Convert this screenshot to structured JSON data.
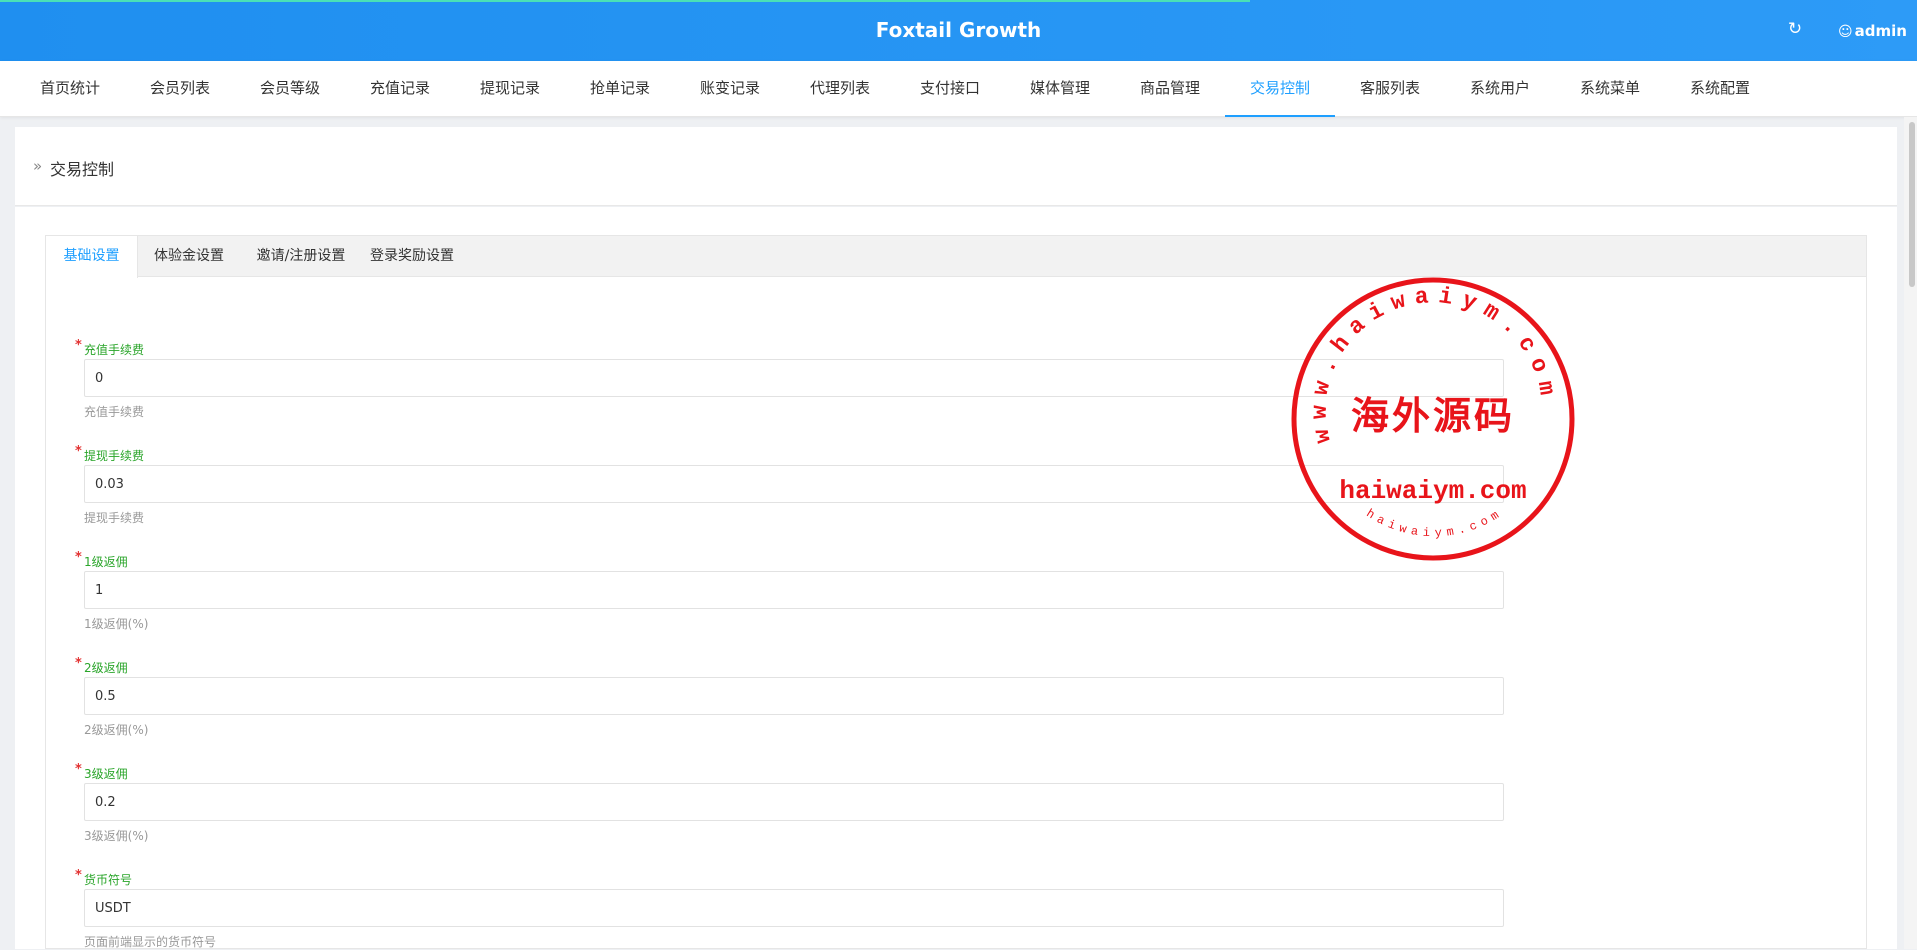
{
  "header": {
    "app_title": "Foxtail Growth",
    "refresh_icon": "refresh-icon",
    "user_icon": "user-icon",
    "user_name": "admin",
    "brand_color": "#1f8ff0"
  },
  "nav": {
    "items": [
      {
        "label": "首页统计"
      },
      {
        "label": "会员列表"
      },
      {
        "label": "会员等级"
      },
      {
        "label": "充值记录"
      },
      {
        "label": "提现记录"
      },
      {
        "label": "抢单记录"
      },
      {
        "label": "账变记录"
      },
      {
        "label": "代理列表"
      },
      {
        "label": "支付接口"
      },
      {
        "label": "媒体管理"
      },
      {
        "label": "商品管理"
      },
      {
        "label": "交易控制"
      },
      {
        "label": "客服列表"
      },
      {
        "label": "系统用户"
      },
      {
        "label": "系统菜单"
      },
      {
        "label": "系统配置"
      }
    ],
    "active_label": "交易控制",
    "active_color": "#1e9fff"
  },
  "breadcrumb": {
    "chevron_icon": "double-chevron-right-icon",
    "title": "交易控制"
  },
  "tabs": [
    {
      "label": "基础设置",
      "active": true
    },
    {
      "label": "体验金设置",
      "active": false
    },
    {
      "label": "邀请/注册设置",
      "active": false
    },
    {
      "label": "登录奖励设置",
      "active": false
    }
  ],
  "form": {
    "required_mark": "*",
    "label_color": "#2aa52a",
    "fields": [
      {
        "label": "充值手续费",
        "value": "0",
        "hint": "充值手续费"
      },
      {
        "label": "提现手续费",
        "value": "0.03",
        "hint": "提现手续费"
      },
      {
        "label": "1级返佣",
        "value": "1",
        "hint": "1级返佣(%)"
      },
      {
        "label": "2级返佣",
        "value": "0.5",
        "hint": "2级返佣(%)"
      },
      {
        "label": "3级返佣",
        "value": "0.2",
        "hint": "3级返佣(%)"
      },
      {
        "label": "货币符号",
        "value": "USDT",
        "hint": "页面前端显示的货币符号"
      }
    ]
  },
  "watermark": {
    "ring_text": "www.haiwaiym.com",
    "center_text": "海外源码",
    "domain_text": "haiwaiym.com",
    "small_text": "haiwaiym.com",
    "color": "#e8141a"
  }
}
